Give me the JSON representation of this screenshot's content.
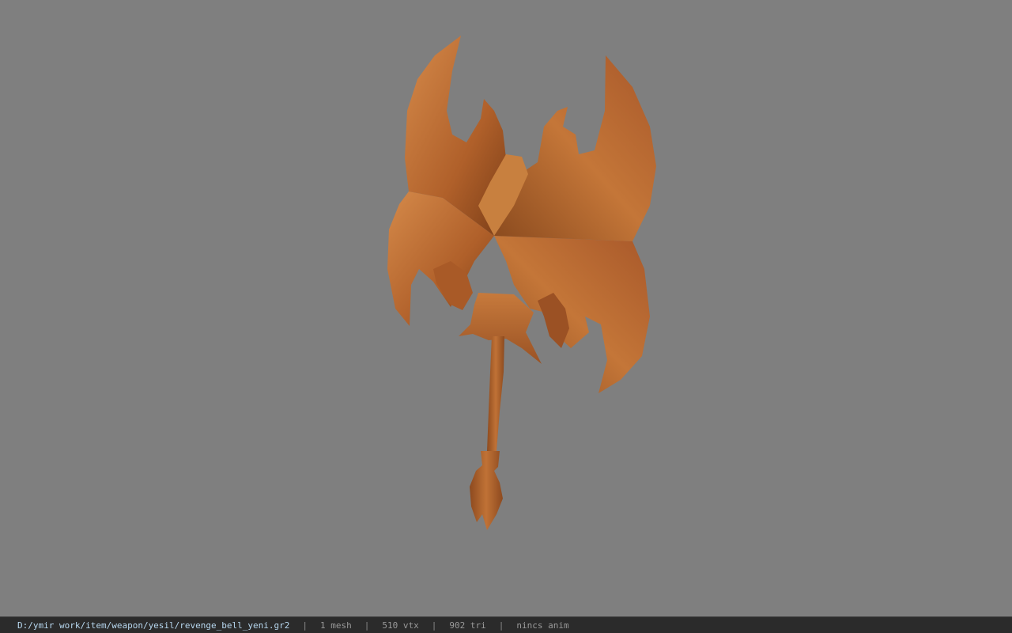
{
  "viewport": {
    "background": "#7f7f7f",
    "model_color": "#b5652c"
  },
  "status": {
    "file_path": "D:/ymir work/item/weapon/yesil/revenge_bell_yeni.gr2",
    "separator": "|",
    "mesh": "1 mesh",
    "vertices": "510 vtx",
    "triangles": "902 tri",
    "animation": "nincs anim"
  }
}
